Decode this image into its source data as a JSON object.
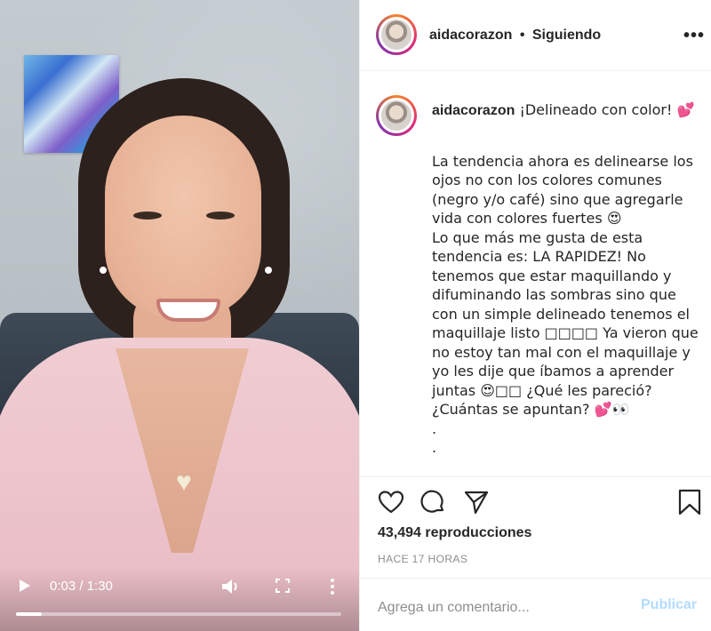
{
  "video": {
    "time": "0:03 / 1:30",
    "progress_fraction": 0.08,
    "icons": [
      "play-icon",
      "volume-icon",
      "fullscreen-icon",
      "more-vertical-icon"
    ]
  },
  "header": {
    "username": "aidacorazon",
    "separator": "•",
    "follow_status": "Siguiendo",
    "more": "•••"
  },
  "caption": {
    "username": "aidacorazon",
    "first_line": " ¡Delineado con color! 💕",
    "body": "La tendencia ahora es delinearse los ojos no con los colores comunes (negro y/o café) sino que agregarle vida con colores fuertes 😍\nLo que más me gusta de esta tendencia es: LA RAPIDEZ! No tenemos que estar maquillando y difuminando las sombras sino que con un simple delineado tenemos el maquillaje listo □□□□ Ya vieron que no estoy tan mal con el maquillaje y yo les dije que íbamos a aprender juntas 😍□□ ¿Qué les pareció? ¿Cuántas se apuntan? 💕👀\n.\n."
  },
  "stats": {
    "views": "43,494 reproducciones",
    "time_ago": "HACE 17 HORAS"
  },
  "comment": {
    "placeholder": "Agrega un comentario...",
    "post_label": "Publicar"
  },
  "colors": {
    "text": "#262626",
    "muted": "#8e8e8e",
    "post_disabled": "#b3dbff",
    "robe": "#ecc2ca"
  }
}
